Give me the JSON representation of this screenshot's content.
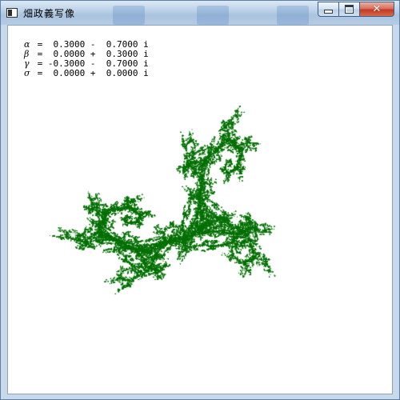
{
  "window": {
    "title": "畑政義写像",
    "icon": "app-window-icon",
    "controls": {
      "minimize": "minimize-icon",
      "maximize": "maximize-icon",
      "close_glyph": "✕"
    }
  },
  "parameters": [
    {
      "symbol": "α",
      "sep": " = ",
      "value": " 0.3000 -  0.7000 i"
    },
    {
      "symbol": "β",
      "sep": " = ",
      "value": " 0.0000 +  0.3000 i"
    },
    {
      "symbol": "γ",
      "sep": " = ",
      "value": "-0.3000 -  0.7000 i"
    },
    {
      "symbol": "σ",
      "sep": " = ",
      "value": " 0.0000 +  0.0000 i"
    }
  ],
  "fractal": {
    "color": "#007000",
    "description_icon": "fractal-render"
  }
}
